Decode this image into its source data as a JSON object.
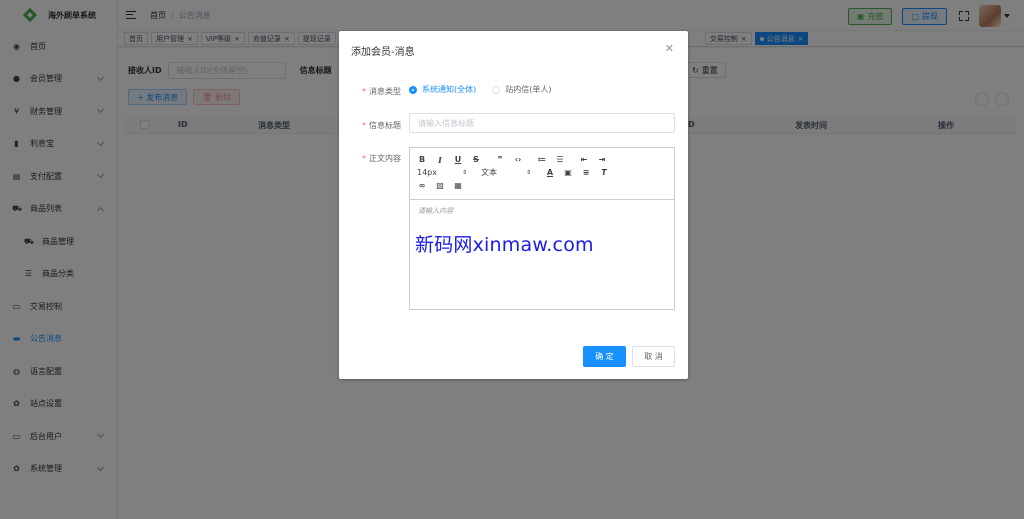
{
  "sidebar": {
    "logo_text": "海外刷单系统",
    "items": [
      {
        "label": "首页",
        "icon": "dashboard-icon"
      },
      {
        "label": "会员管理",
        "icon": "user-icon"
      },
      {
        "label": "财务管理",
        "icon": "yen-icon"
      },
      {
        "label": "利息宝",
        "icon": "bar-chart-icon"
      },
      {
        "label": "支付配置",
        "icon": "document-icon"
      },
      {
        "label": "商品列表",
        "icon": "cart-icon"
      },
      {
        "label": "商品管理",
        "icon": "cart-icon"
      },
      {
        "label": "商品分类",
        "icon": "list-icon"
      },
      {
        "label": "交易控制",
        "icon": "monitor-icon"
      },
      {
        "label": "公告消息",
        "icon": "chat-icon"
      },
      {
        "label": "语言配置",
        "icon": "globe-icon"
      },
      {
        "label": "站点设置",
        "icon": "gear-icon"
      },
      {
        "label": "后台用户",
        "icon": "monitor-icon"
      },
      {
        "label": "系统管理",
        "icon": "gear-icon"
      }
    ]
  },
  "header": {
    "breadcrumb_home": "首页",
    "breadcrumb_current": "公告消息",
    "charge_label": "充值",
    "withdraw_label": "提现"
  },
  "tags": [
    {
      "label": "首页"
    },
    {
      "label": "用户管理"
    },
    {
      "label": "VIP等级"
    },
    {
      "label": "充值记录"
    },
    {
      "label": "提现记录"
    },
    {
      "label": "交易控制"
    },
    {
      "label": "公告消息"
    }
  ],
  "filters": {
    "receiver_label": "接收人ID",
    "receiver_placeholder": "接收人ID(全体留空)",
    "title_label": "信息标题",
    "reset_label": "重置"
  },
  "actions": {
    "publish_label": "+ 发布消息",
    "delete_label": "删除"
  },
  "table": {
    "columns": [
      "ID",
      "消息类型",
      "ID",
      "发表时间",
      "操作"
    ]
  },
  "dialog": {
    "title": "添加会员-消息",
    "type_label": "消息类型",
    "type_options": [
      {
        "label": "系统通知(全体)",
        "checked": true
      },
      {
        "label": "站内信(单人)",
        "checked": false
      }
    ],
    "title_field_label": "信息标题",
    "title_placeholder": "请输入信息标题",
    "content_label": "正文内容",
    "font_size": "14px",
    "text_style": "文本",
    "content_placeholder": "请输入内容",
    "watermark": "新码网xinmaw.com",
    "confirm_label": "确 定",
    "cancel_label": "取 消"
  }
}
